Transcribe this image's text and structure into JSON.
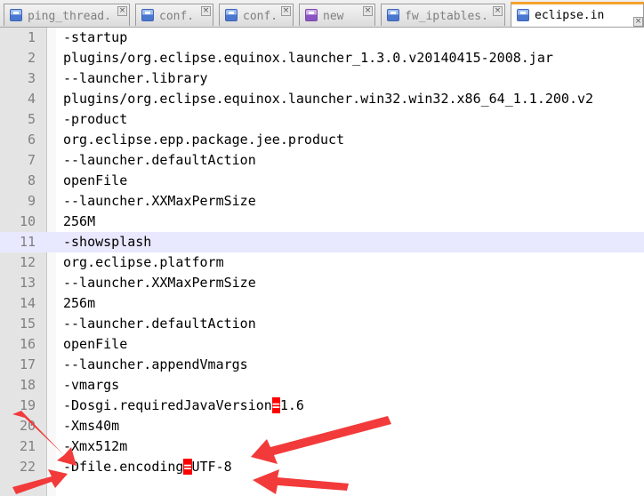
{
  "tabs": [
    {
      "label": "ping_thread.",
      "active": false,
      "icon": "disk-icon"
    },
    {
      "label": "conf.",
      "active": false,
      "icon": "disk-icon"
    },
    {
      "label": "conf.",
      "active": false,
      "icon": "disk-icon"
    },
    {
      "label": "new",
      "active": false,
      "icon": "disk-icon"
    },
    {
      "label": "fw_iptables.",
      "active": false,
      "icon": "disk-icon"
    },
    {
      "label": "eclipse.in",
      "active": true,
      "icon": "disk-icon"
    }
  ],
  "close_glyph": "×",
  "current_line": 11,
  "lines": [
    {
      "num": "1",
      "text": "-startup"
    },
    {
      "num": "2",
      "text": "plugins/org.eclipse.equinox.launcher_1.3.0.v20140415-2008.jar"
    },
    {
      "num": "3",
      "text": "--launcher.library"
    },
    {
      "num": "4",
      "text": "plugins/org.eclipse.equinox.launcher.win32.win32.x86_64_1.1.200.v2"
    },
    {
      "num": "5",
      "text": "-product"
    },
    {
      "num": "6",
      "text": "org.eclipse.epp.package.jee.product"
    },
    {
      "num": "7",
      "text": "--launcher.defaultAction"
    },
    {
      "num": "8",
      "text": "openFile"
    },
    {
      "num": "9",
      "text": "--launcher.XXMaxPermSize"
    },
    {
      "num": "10",
      "text": "256M"
    },
    {
      "num": "11",
      "text": "-showsplash"
    },
    {
      "num": "12",
      "text": "org.eclipse.platform"
    },
    {
      "num": "13",
      "text": "--launcher.XXMaxPermSize"
    },
    {
      "num": "14",
      "text": "256m"
    },
    {
      "num": "15",
      "text": "--launcher.defaultAction"
    },
    {
      "num": "16",
      "text": "openFile"
    },
    {
      "num": "17",
      "text": "--launcher.appendVmargs"
    },
    {
      "num": "18",
      "text": "-vmargs"
    },
    {
      "num": "19",
      "pre": "-Dosgi.requiredJavaVersion",
      "eq": "=",
      "post": "1.6"
    },
    {
      "num": "20",
      "text": "-Xms40m"
    },
    {
      "num": "21",
      "text": "-Xmx512m"
    },
    {
      "num": "22",
      "pre": "-Dfile.encoding",
      "eq": "=",
      "post": "UTF-8"
    }
  ],
  "colors": {
    "annotation_arrow": "#f23a3a",
    "current_line_bg": "#e8e8ff",
    "active_tab_accent": "#f4a22d"
  }
}
